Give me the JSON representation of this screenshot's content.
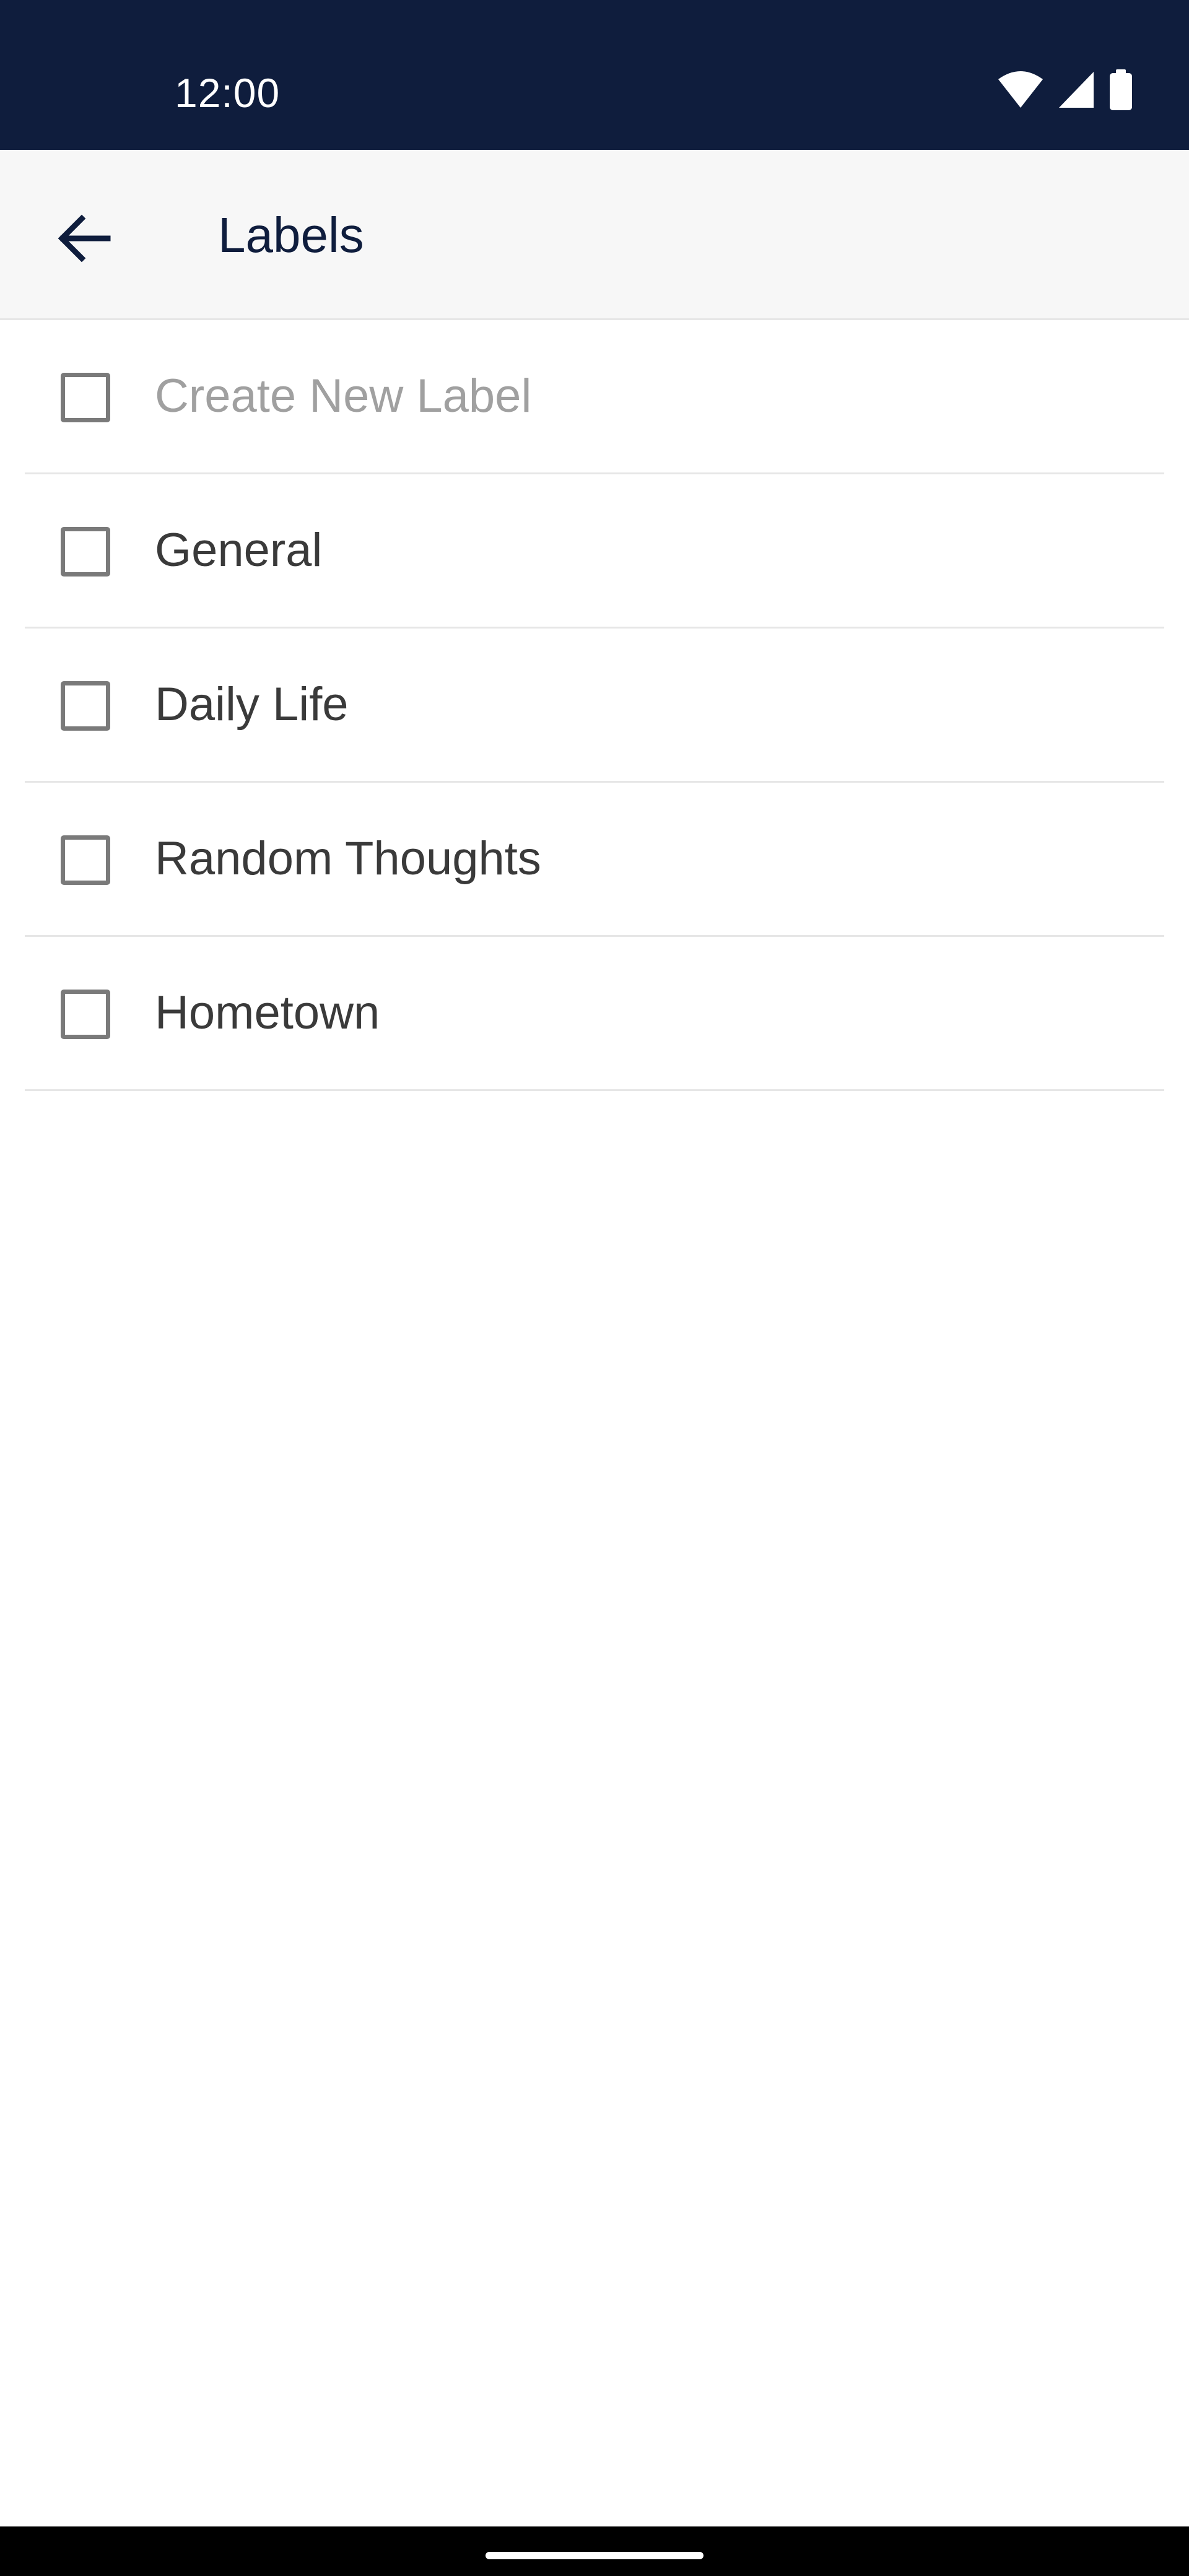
{
  "status_bar": {
    "time": "12:00",
    "icons": [
      "wifi-icon",
      "cellular-signal-icon",
      "battery-icon"
    ],
    "background": "#0f1d3d"
  },
  "app_bar": {
    "back_icon": "arrow-left-icon",
    "title": "Labels",
    "background": "#f7f7f7"
  },
  "labels": {
    "create_placeholder": "Create New Label",
    "items": [
      {
        "label": "General",
        "checked": false
      },
      {
        "label": "Daily Life",
        "checked": false
      },
      {
        "label": "Random Thoughts",
        "checked": false
      },
      {
        "label": "Hometown",
        "checked": false
      }
    ]
  },
  "colors": {
    "accent": "#0f1d3d",
    "text": "#3a3a3a",
    "placeholder": "#a0a0a0",
    "checkbox_border": "#7a7a7a",
    "divider": "#e6e6e6"
  }
}
